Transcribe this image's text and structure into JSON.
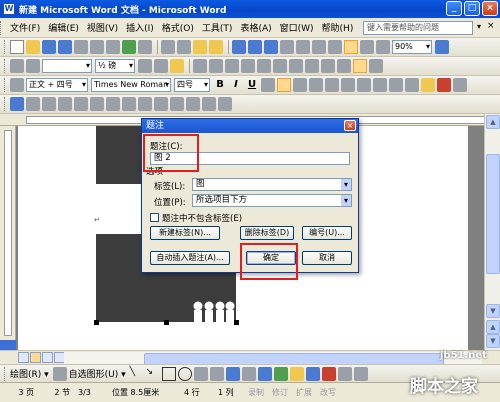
{
  "window": {
    "title": "新建 Microsoft Word 文档 - Microsoft Word",
    "app_icon": "W",
    "controls": {
      "minimize": "_",
      "maximize": "□",
      "close": "×"
    }
  },
  "menubar": {
    "items": [
      "文件(F)",
      "编辑(E)",
      "视图(V)",
      "插入(I)",
      "格式(O)",
      "工具(T)",
      "表格(A)",
      "窗口(W)",
      "帮助(H)"
    ],
    "help_placeholder": "键入需要帮助的问题",
    "close": "×"
  },
  "toolbar_standard": {
    "zoom": "90%"
  },
  "toolbar_drawing_line": {
    "line_weight": "½ 磅"
  },
  "toolbar_formatting": {
    "style": "正文 + 四号",
    "font": "Times New Roman",
    "size": "四号",
    "bold": "B",
    "italic": "I",
    "underline": "U"
  },
  "dialog": {
    "title": "题注",
    "close": "×",
    "caption_label": "题注(C):",
    "caption_value": "图 2",
    "options_label": "选项",
    "label_label": "标签(L):",
    "label_value": "图",
    "position_label": "位置(P):",
    "position_value": "所选项目下方",
    "exclude_label": "题注中不包含标签(E)",
    "new_label_button": "新建标签(N)...",
    "delete_label_button": "删除标签(D)",
    "numbering_button": "编号(U)...",
    "autocaption_button": "自动插入题注(A)...",
    "ok_button": "确定",
    "cancel_button": "取消"
  },
  "drawing_toolbar": {
    "draw": "绘图(R) ▾",
    "autoshapes": "自选图形(U) ▾"
  },
  "statusbar": {
    "page": "3 页",
    "section": "2 节",
    "page_of": "3/3",
    "position": "位置 8.5厘米",
    "line": "4 行",
    "column": "1 列",
    "rec": "录制",
    "trk": "修订",
    "ext": "扩展",
    "ovr": "改写"
  },
  "watermark": {
    "url": "jb51.net",
    "brand": "脚本之家"
  }
}
